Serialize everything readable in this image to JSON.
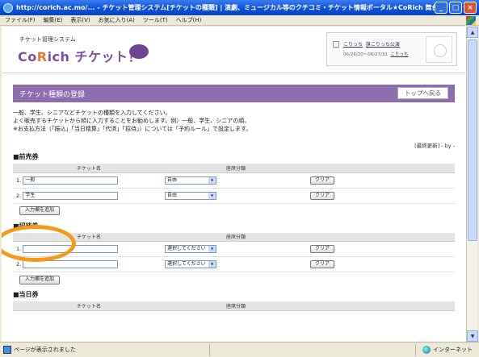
{
  "window": {
    "title": "http://corich.ac.mo/... - チケット管理システム[チケットの種類] | 演劇、ミュージカル等のクチコミ・チケット情報ポータル★CoRich 舞台芸術！ - Microsof...",
    "min": "_",
    "max": "□",
    "close": "×"
  },
  "menu": [
    "ファイル(F)",
    "編集(E)",
    "表示(V)",
    "お気に入り(A)",
    "ツール(T)",
    "ヘルプ(H)"
  ],
  "header": {
    "system_label": "チケット管理システム",
    "brand_main": "Co",
    "brand_r": "R",
    "brand_tail": "ich チケット！",
    "user_name": "こりっち",
    "user_link": "旗こりっち公演",
    "user_dates": "06/26/20～06/27/31",
    "user_link2": "こりっち"
  },
  "page": {
    "title": "チケット種類の登録",
    "top_button": "トップへ戻る",
    "desc_lines": [
      "一般、学生、シニアなどチケットの種類を入力してください。",
      "よく販売するチケットから順に入力することをお勧めします。例）一般、学生、シニアの順。",
      "※お支払方法（「振込」「当日精算」「代済」「招待」）については「予約ルール」で設定します。"
    ],
    "updated": "[最終更新] - by -"
  },
  "table_headers": {
    "name": "チケット名",
    "seat": "座席分類"
  },
  "sections": [
    {
      "title": "■前売券",
      "rows": [
        {
          "num": "1.",
          "name": "一般",
          "seat": "自由",
          "clear": "クリア"
        },
        {
          "num": "2.",
          "name": "学生",
          "seat": "自由",
          "clear": "クリア"
        }
      ],
      "add": "入力欄を追加"
    },
    {
      "title": "■招待券",
      "rows": [
        {
          "num": "1.",
          "name": "",
          "seat": "選択してください",
          "clear": "クリア"
        },
        {
          "num": "2.",
          "name": "",
          "seat": "選択してください",
          "clear": "クリア"
        }
      ],
      "add": "入力欄を追加"
    },
    {
      "title": "■当日券",
      "rows": [],
      "add": ""
    }
  ],
  "status": {
    "left": "ページが表示されました",
    "zone": "インターネット"
  },
  "colors": {
    "accent": "#8c6dae",
    "highlight": "#f29b1a"
  }
}
